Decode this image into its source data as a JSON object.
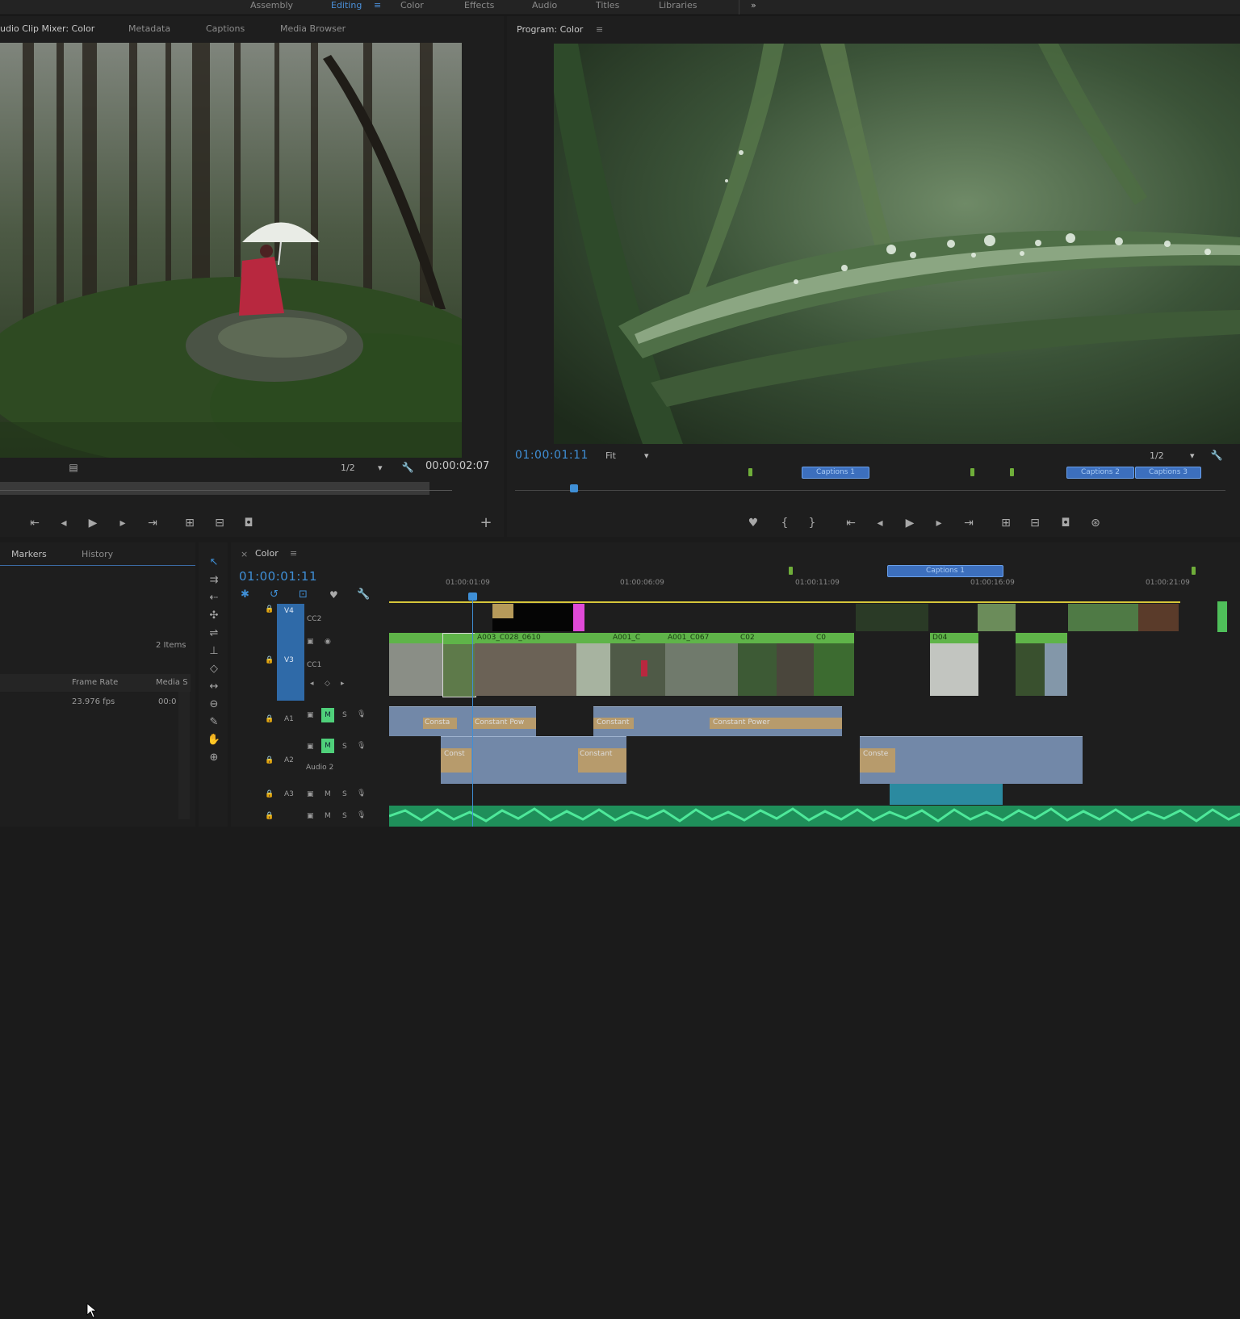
{
  "workspaces": [
    {
      "label": "Assembly",
      "active": false
    },
    {
      "label": "Editing",
      "active": true
    },
    {
      "label": "Color",
      "active": false
    },
    {
      "label": "Effects",
      "active": false
    },
    {
      "label": "Audio",
      "active": false
    },
    {
      "label": "Titles",
      "active": false
    },
    {
      "label": "Libraries",
      "active": false
    }
  ],
  "workspace_more": "»",
  "workspace_menu": "≡",
  "source": {
    "tabs": [
      "udio Clip Mixer: Color",
      "Metadata",
      "Captions",
      "Media Browser"
    ],
    "resolution": "1/2",
    "timecode": "00:00:02:07"
  },
  "program": {
    "title": "Program: Color",
    "menu": "≡",
    "timecode": "01:00:01:11",
    "zoom": "Fit",
    "resolution": "1/2",
    "captions": [
      "Captions 1",
      "Captions 2",
      "Captions 3"
    ]
  },
  "project": {
    "tabs": [
      "Markers",
      "History"
    ],
    "items_count": "2 Items",
    "col_frame_rate": "Frame Rate",
    "col_media": "Media S",
    "row_frame_rate": "23.976 fps",
    "row_media": "00:0"
  },
  "timeline": {
    "tab_close": "×",
    "tab_title": "Color",
    "tab_menu": "≡",
    "timecode": "01:00:01:11",
    "ruler": [
      "01:00:01:09",
      "01:00:06:09",
      "01:00:11:09",
      "01:00:16:09",
      "01:00:21:09"
    ],
    "caption_track": "Captions 1",
    "tracks": {
      "v4": "V4",
      "cc2": "CC2",
      "v3": "V3",
      "cc1": "CC1",
      "a1": "A1",
      "a2": "A2",
      "a3": "A3",
      "audio2": "Audio 2",
      "m": "M",
      "s": "S"
    },
    "video_clips": [
      "A003_C028_0610",
      "A001_C",
      "A001_C067",
      "C02",
      "C0",
      "D04"
    ],
    "audio_labels": {
      "consta": "Consta",
      "constant_pow": "Constant Pow",
      "constant": "Constant",
      "constant_power": "Constant Power",
      "const": "Const",
      "constant_2": "Constant",
      "conste": "Conste"
    }
  },
  "colors": {
    "timecode_blue": "#3f8fd6",
    "video_clip_green": "#5fb449",
    "audio_clip_blue": "#7288a8",
    "audio_green": "#2fbf7a",
    "caption_blue": "#3c6fbd"
  }
}
